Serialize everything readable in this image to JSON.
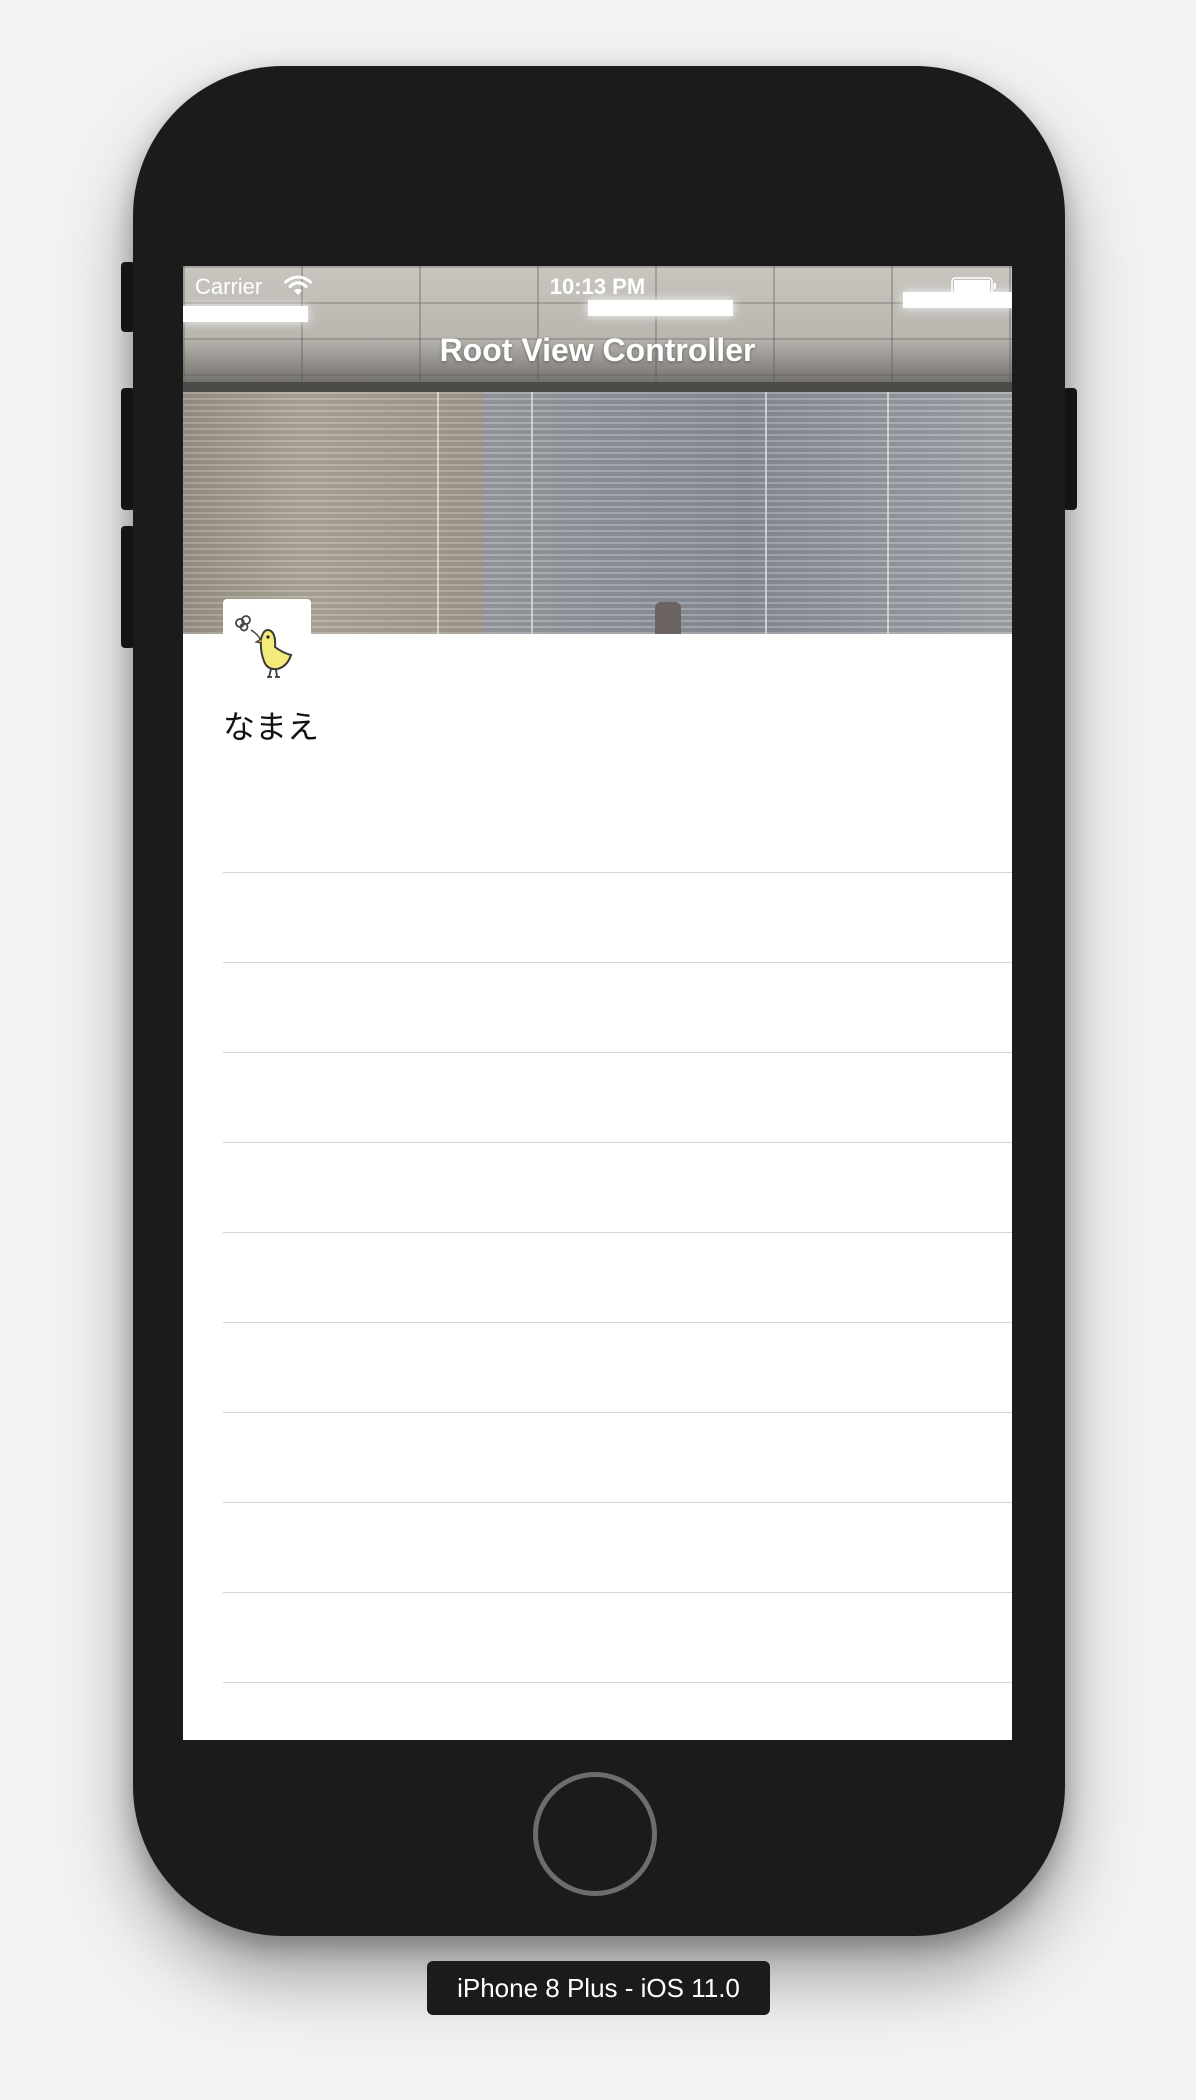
{
  "status_bar": {
    "carrier": "Carrier",
    "time": "10:13 PM",
    "wifi_icon": "wifi-icon",
    "battery_icon": "battery-icon"
  },
  "nav_bar": {
    "title": "Root View Controller"
  },
  "profile": {
    "avatar_icon": "bird-icon",
    "name": "なまえ"
  },
  "table": {
    "row_count": 10
  },
  "device": {
    "label": "iPhone 8 Plus - iOS 11.0"
  },
  "colors": {
    "device_body": "#1b1b1b",
    "screen_background": "#ffffff",
    "separator": "#d5d5d8",
    "bird": "#f4ea7a"
  }
}
